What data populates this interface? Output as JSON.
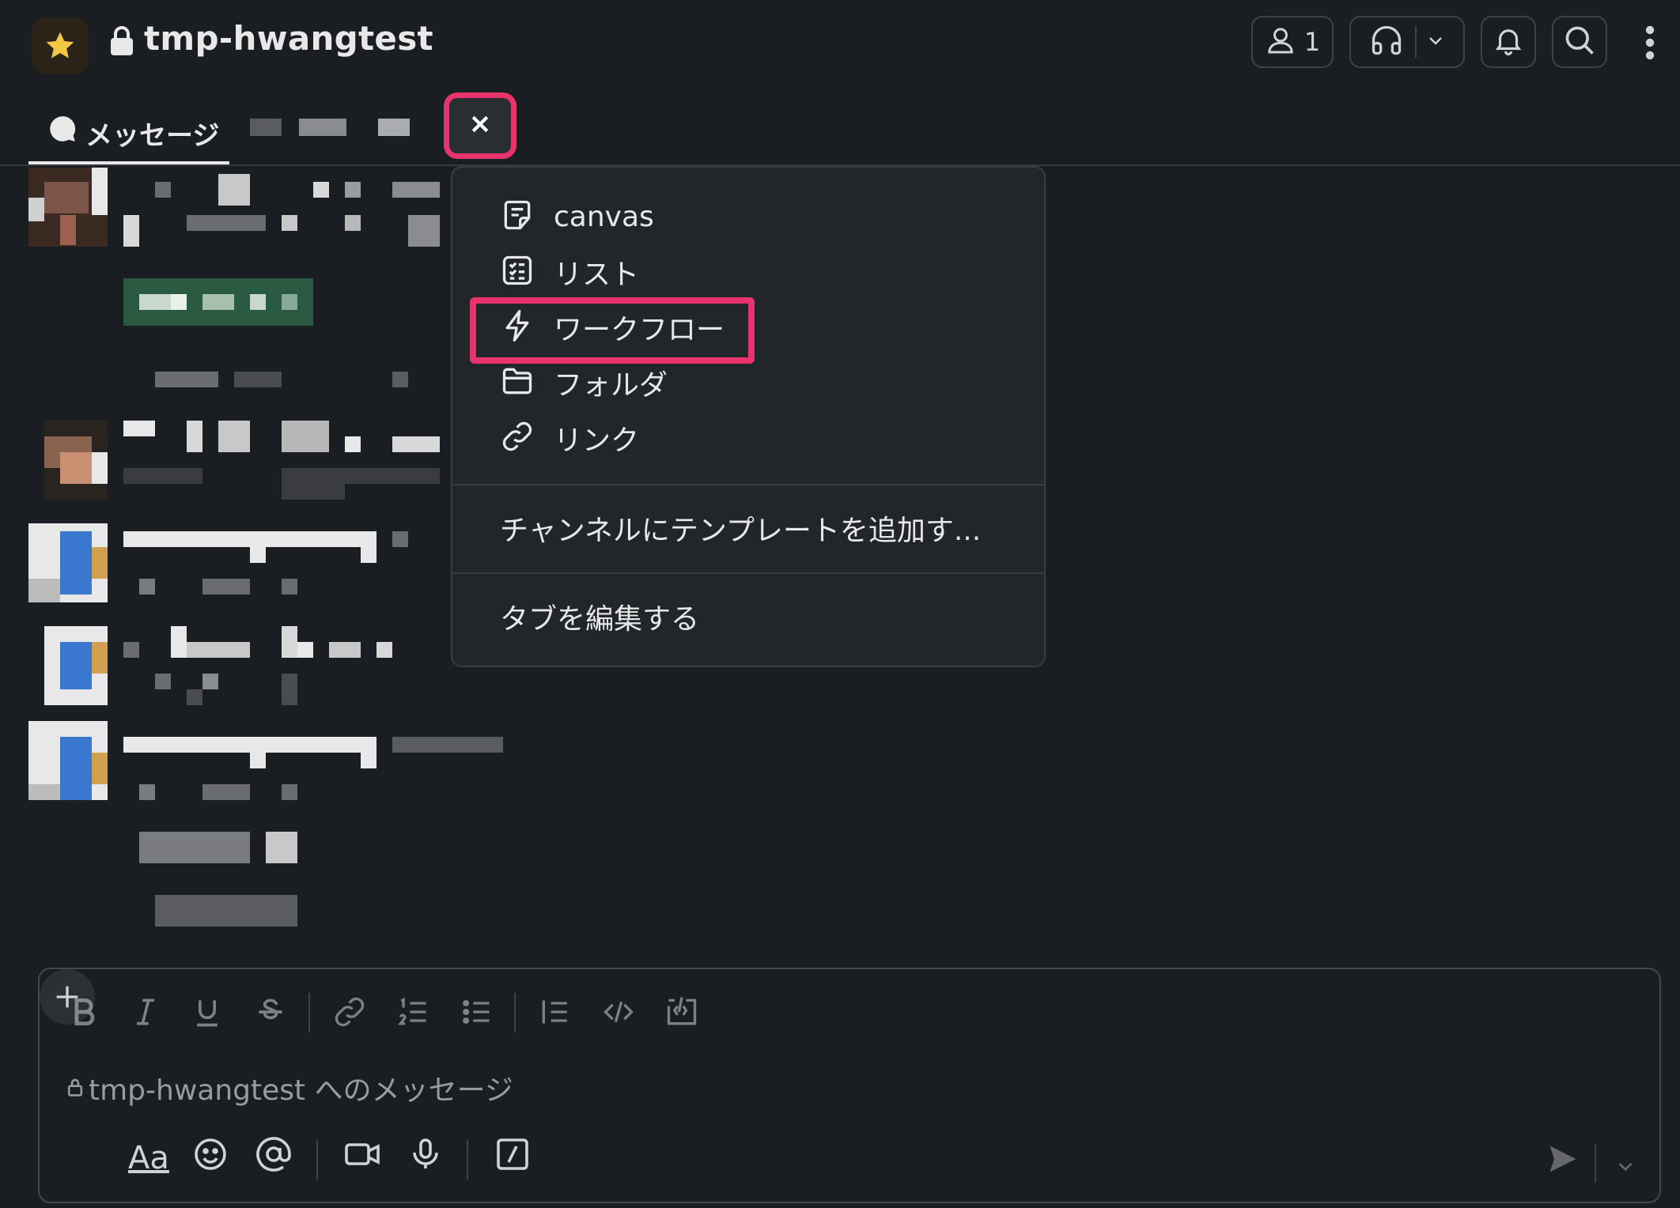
{
  "header": {
    "channel_name": "tmp-hwangtest",
    "member_count": "1",
    "icons": [
      "star-icon",
      "lock-icon",
      "person-icon",
      "headphones-icon",
      "chevron-down-icon",
      "bell-icon",
      "search-icon",
      "more-vertical-icon"
    ]
  },
  "tabs": {
    "messages_label": "メッセージ",
    "close_icon": "close-icon"
  },
  "menu": {
    "items": [
      {
        "label": "canvas",
        "icon": "canvas-icon"
      },
      {
        "label": "リスト",
        "icon": "list-icon"
      },
      {
        "label": "ワークフロー",
        "icon": "workflow-icon",
        "highlighted": true
      },
      {
        "label": "フォルダ",
        "icon": "folder-icon"
      },
      {
        "label": "リンク",
        "icon": "link-icon"
      }
    ],
    "template_label": "チャンネルにテンプレートを追加す...",
    "edit_tabs_label": "タブを編集する"
  },
  "composer": {
    "placeholder": "tmp-hwangtest へのメッセージ",
    "format_label": "Aa",
    "formatting_icons": [
      "bold-icon",
      "italic-icon",
      "underline-icon",
      "strikethrough-icon",
      "link-icon",
      "ordered-list-icon",
      "bulleted-list-icon",
      "blockquote-icon",
      "code-icon",
      "code-block-icon"
    ],
    "action_icons": [
      "plus-icon",
      "emoji-icon",
      "mention-icon",
      "video-icon",
      "microphone-icon",
      "slash-command-icon",
      "send-icon",
      "chevron-down-icon"
    ]
  },
  "colors": {
    "background": "#1a1d21",
    "highlight": "#e8336d",
    "star": "#f2c744",
    "menu_bg": "#222529"
  }
}
